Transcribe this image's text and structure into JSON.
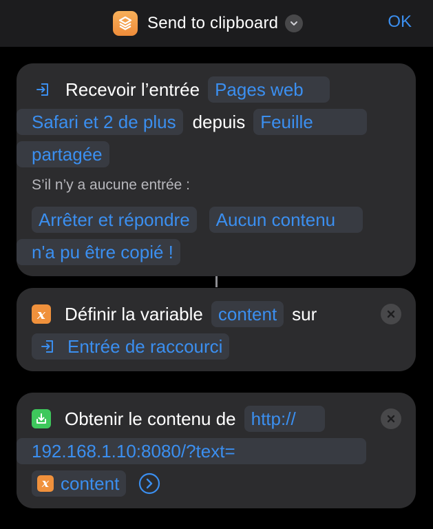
{
  "header": {
    "title": "Send to clipboard",
    "ok_label": "OK",
    "app_icon": "layers-icon",
    "menu_icon": "chevron-down-icon"
  },
  "actions": [
    {
      "name": "receive-input",
      "icon": "input-icon",
      "label": "Recevoir l’entrée",
      "types_line1": "Pages web",
      "types_line2": "Safari et 2 de plus",
      "from_label": "depuis",
      "source_line1": "Feuille",
      "source_line2": "partagée",
      "no_input_label": "S’il n’y a aucune entrée :",
      "behavior": "Arrêter et répondre",
      "response_line1": "Aucun contenu",
      "response_line2": "n'a pu être copié !"
    },
    {
      "name": "set-variable",
      "icon": "variable-icon",
      "label": "Définir la variable",
      "variable": "content",
      "to_label": "sur",
      "value": "Entrée de raccourci",
      "remove_icon": "close-icon"
    },
    {
      "name": "get-contents",
      "icon": "download-icon",
      "label": "Obtenir le contenu de",
      "url_line1": "http://",
      "url_line2": "192.168.1.10:8080/?text=",
      "variable": "content",
      "expand_icon": "chevron-right-icon",
      "remove_icon": "close-icon"
    }
  ],
  "colors": {
    "accent": "#3b8ff0",
    "card_bg": "#2c2c2e",
    "header_bg": "#1c1c1e",
    "variable_orange": "#f0913c",
    "download_green": "#3ec85c"
  }
}
